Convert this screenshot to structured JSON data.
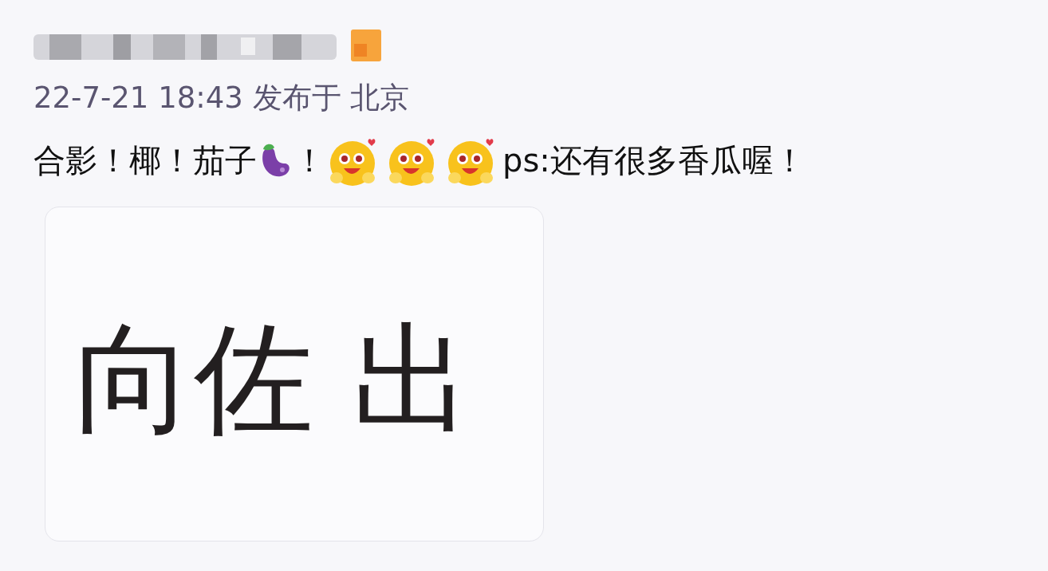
{
  "post": {
    "meta": "22-7-21 18:43 发布于 北京",
    "content": [
      {
        "kind": "text",
        "text": "合影！椰！茄子"
      },
      {
        "kind": "eggplant"
      },
      {
        "kind": "text",
        "text": "！"
      },
      {
        "kind": "smiley"
      },
      {
        "kind": "smiley"
      },
      {
        "kind": "smiley"
      },
      {
        "kind": "text",
        "text": "ps:还有很多香瓜喔！"
      }
    ],
    "image_card": {
      "text": "向佐 出"
    }
  }
}
